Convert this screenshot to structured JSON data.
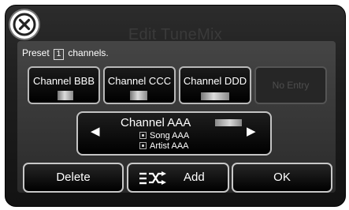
{
  "header": {
    "title": "Edit TuneMix"
  },
  "preset": {
    "prefix": "Preset",
    "count": "1",
    "suffix": "channels."
  },
  "channels": [
    {
      "label": "Channel BBB"
    },
    {
      "label": "Channel CCC"
    },
    {
      "label": "Channel DDD"
    },
    {
      "label": "No Entry"
    }
  ],
  "now_playing": {
    "channel": "Channel AAA",
    "song": "Song AAA",
    "artist": "Artist AAA",
    "prev_arrow": "◀",
    "next_arrow": "▶"
  },
  "buttons": {
    "delete_label": "Delete",
    "add_label": "Add",
    "ok_label": "OK"
  },
  "icons": {
    "close": "close-icon",
    "shuffle": "shuffle-list-icon",
    "song": "song-icon",
    "artist": "artist-icon"
  }
}
